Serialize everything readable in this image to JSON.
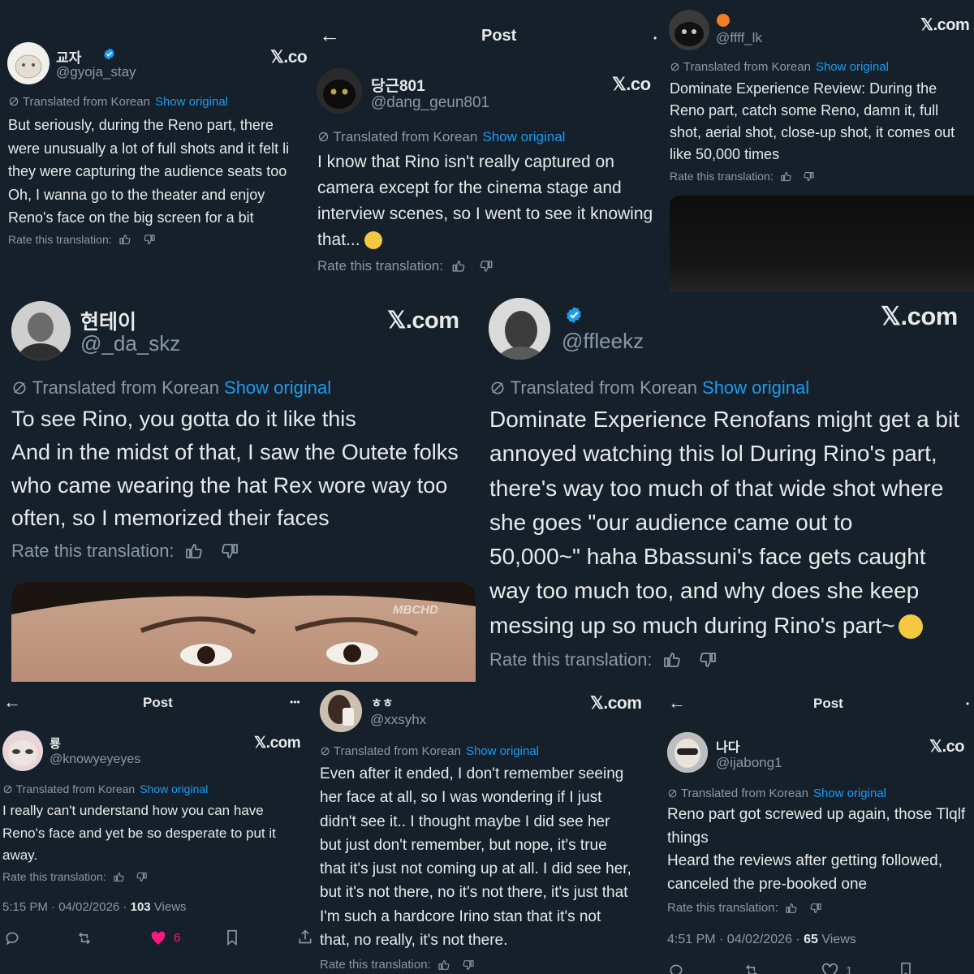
{
  "common": {
    "x_logo": "𝕏.com",
    "translated": "Translated from Korean",
    "show_original": "Show original",
    "rate": "Rate this translation:",
    "post_title": "Post",
    "more": "•••",
    "back": "←"
  },
  "p1": {
    "name": "교자",
    "handle": "@gyoja_stay",
    "logo": "𝕏.co",
    "lines": [
      "But seriously, during the Reno part, there",
      "were unusually a lot of full shots and it felt li",
      "they were capturing the audience seats too",
      "Oh, I wanna go to the theater and enjoy",
      "Reno's face on the big screen for a bit"
    ]
  },
  "p2": {
    "name": "당근801",
    "handle": "@dang_geun801",
    "logo": "𝕏.co",
    "lines": [
      "I know that Rino isn't really captured on",
      "camera except for the cinema stage and",
      "interview scenes, so I went to see it knowing",
      "that..."
    ]
  },
  "p3": {
    "handle": "@ffff_lk",
    "logo": "𝕏.com",
    "lines": [
      "Dominate Experience Review: During the",
      "Reno part, catch some Reno, damn it, full",
      "shot, aerial shot, close-up shot, it comes out",
      "like 50,000 times"
    ]
  },
  "p4": {
    "name": "현테이",
    "handle": "@_da_skz",
    "logo": "𝕏.com",
    "lines": [
      "To see Rino, you gotta do it like this",
      "And in the midst of that, I saw the Outete folks",
      "who came wearing the hat Rex wore way too",
      "often, so I memorized their faces"
    ],
    "watermark": "MBCHD"
  },
  "p5": {
    "handle": "@ffleekz",
    "logo": "𝕏.com",
    "lines": [
      "Dominate Experience Renofans might get a bit",
      "annoyed watching this lol During Rino's part,",
      "there's way too much of that wide shot where",
      "she goes \"our audience came out to",
      "50,000~\" haha Bbassuni's face gets caught",
      "way too much too, and why does she keep",
      "messing up so much during Rino's part~"
    ]
  },
  "p6": {
    "name": "룡",
    "handle": "@knowyeyeyes",
    "logo": "𝕏.com",
    "lines": [
      "I really can't understand how you can have",
      "Reno's face and yet be so desperate to put it",
      "away."
    ],
    "time": "5:15 PM · 04/02/2026 · ",
    "views_count": "103",
    "views_label": " Views",
    "likes": "6"
  },
  "p7": {
    "name": "ㅎㅎ",
    "handle": "@xxsyhx",
    "logo": "𝕏.com",
    "lines": [
      "Even after it ended, I don't remember seeing",
      "her face at all, so I was wondering if I just",
      "didn't see it.. I thought maybe I did see her",
      "but just don't remember, but nope, it's true",
      "that it's just not coming up at all. I did see her,",
      "but it's not there, no it's not there, it's just that",
      "I'm such a hardcore Irino stan that it's not",
      "that, no really, it's not there."
    ]
  },
  "p8": {
    "name": "나다",
    "handle": "@ijabong1",
    "logo": "𝕏.co",
    "lines": [
      "Reno part got screwed up again, those Tlqlf",
      "things",
      "Heard the reviews after getting followed,",
      "canceled the pre-booked one"
    ],
    "time": "4:51 PM · 04/02/2026 · ",
    "views_count": "65",
    "views_label": " Views",
    "likes": "1"
  },
  "colors": {
    "background": "#15202b",
    "text": "#e7e9ea",
    "muted": "#8b98a5",
    "link": "#1d9bf0",
    "like": "#f91880"
  }
}
